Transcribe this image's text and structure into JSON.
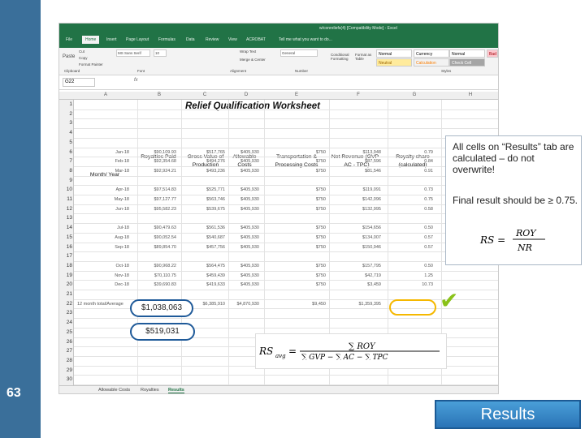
{
  "slide": {
    "number": "63",
    "results_button": "Results"
  },
  "excel": {
    "title": "w/conreliefs(4) [Compatibility Mode] - Excel",
    "tabs": [
      "File",
      "Home",
      "Insert",
      "Page Layout",
      "Formulas",
      "Data",
      "Review",
      "View",
      "ACROBAT"
    ],
    "tell_me": "Tell me what you want to do...",
    "ribbon": {
      "cut": "Cut",
      "copy": "Copy",
      "format_painter": "Format Painter",
      "paste": "Paste",
      "font_name": "MS Sans Serif",
      "font_size": "10",
      "wrap_text": "Wrap Text",
      "merge_center": "Merge & Center",
      "number_format": "General",
      "conditional_formatting": "Conditional Formatting",
      "format_as_table": "Format as Table",
      "styles": [
        "Normal",
        "Currency",
        "Normal",
        "Bad",
        "Neutral",
        "Calculation",
        "Check Cell"
      ],
      "groups": [
        "Clipboard",
        "Font",
        "Alignment",
        "Number",
        "Styles"
      ]
    },
    "name_box": "G22",
    "formula_fx": "fx",
    "columns": [
      "A",
      "B",
      "C",
      "D",
      "E",
      "F",
      "G",
      "H"
    ],
    "rows": [
      "1",
      "2",
      "3",
      "4",
      "5",
      "6",
      "7",
      "8",
      "9",
      "10",
      "11",
      "12",
      "13",
      "14",
      "15",
      "16",
      "17",
      "18",
      "19",
      "20",
      "21",
      "22",
      "23",
      "24",
      "25",
      "26",
      "27",
      "28",
      "29",
      "30"
    ],
    "worksheet_title": "Relief Qualification Worksheet",
    "headers": {
      "month_year": "Month/ Year",
      "royalties": "Royalties Paid",
      "gvp": "Gross Value of Production",
      "allowable": "Allowable Costs",
      "transport": "Transportation & Processing Costs",
      "net_revenue": "Net Revenue (GVP - AC - TPC)",
      "royalty_share": "Royalty share (calculated)"
    },
    "data_rows": [
      {
        "month": "Jan-18",
        "roy": "$90,109.93",
        "gvp": "$517,765",
        "ac": "$405,930",
        "tpc": "$750",
        "nr": "$113,948",
        "rs": "0.79"
      },
      {
        "month": "Feb-18",
        "roy": "$92,354.68",
        "gvp": "$494,276",
        "ac": "$405,930",
        "tpc": "$750",
        "nr": "$87,596",
        "rs": "0.84"
      },
      {
        "month": "Mar-18",
        "roy": "$92,924.21",
        "gvp": "$493,236",
        "ac": "$405,930",
        "tpc": "$750",
        "nr": "$81,546",
        "rs": "0.91"
      },
      {
        "month": "Apr-18",
        "roy": "$97,514.83",
        "gvp": "$525,771",
        "ac": "$405,930",
        "tpc": "$750",
        "nr": "$119,091",
        "rs": "0.73"
      },
      {
        "month": "May-18",
        "roy": "$97,127.77",
        "gvp": "$563,746",
        "ac": "$405,930",
        "tpc": "$750",
        "nr": "$142,096",
        "rs": "0.75"
      },
      {
        "month": "Jun-18",
        "roy": "$95,582.23",
        "gvp": "$539,675",
        "ac": "$405,930",
        "tpc": "$750",
        "nr": "$132,995",
        "rs": "0.58"
      },
      {
        "month": "Jul-18",
        "roy": "$90,479.63",
        "gvp": "$561,536",
        "ac": "$405,930",
        "tpc": "$750",
        "nr": "$154,656",
        "rs": "0.50"
      },
      {
        "month": "Aug-18",
        "roy": "$90,052.54",
        "gvp": "$540,687",
        "ac": "$405,930",
        "tpc": "$750",
        "nr": "$134,007",
        "rs": "0.57"
      },
      {
        "month": "Sep-18",
        "roy": "$89,854.70",
        "gvp": "$457,756",
        "ac": "$405,930",
        "tpc": "$750",
        "nr": "$150,946",
        "rs": "0.57"
      },
      {
        "month": "Oct-18",
        "roy": "$90,968.22",
        "gvp": "$564,475",
        "ac": "$405,930",
        "tpc": "$750",
        "nr": "$157,795",
        "rs": "0.50"
      },
      {
        "month": "Nov-18",
        "roy": "$70,110.75",
        "gvp": "$459,439",
        "ac": "$405,930",
        "tpc": "$750",
        "nr": "$42,719",
        "rs": "1.25"
      },
      {
        "month": "Dec-18",
        "roy": "$39,690.83",
        "gvp": "$419,633",
        "ac": "$405,930",
        "tpc": "$750",
        "nr": "$3,459",
        "rs": "10.73"
      }
    ],
    "total_label": "12 month total/Average",
    "total_values": {
      "gvp": "$6,385,910",
      "ac": "$4,870,930",
      "tpc": "$9,450",
      "nr": "$1,359,395"
    },
    "sheet_tabs": [
      "Allowable Costs",
      "Royalties",
      "Results"
    ],
    "active_sheet": "Results"
  },
  "annotations": {
    "note1": "All cells on “Results” tab are calculated – do not overwrite!",
    "note2": "Final result should be ≥ 0.75.",
    "formula_rs_lhs": "RS =",
    "formula_rs_num": "ROY",
    "formula_rs_den": "NR",
    "bubble_total": "$1,038,063",
    "bubble_average": "$519,031",
    "avg_formula_lhs": "RS",
    "avg_formula_sub": "avg",
    "avg_formula_num": "∑ ROY",
    "avg_formula_den": "∑ GVP − ∑ AC − ∑ TPC",
    "checkmark_color": "#8ac219",
    "highlight_color": "#f5b800"
  }
}
